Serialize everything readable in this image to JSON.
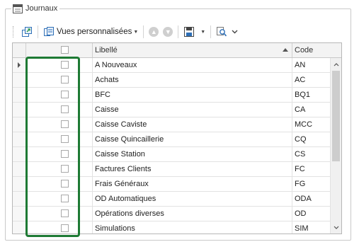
{
  "group": {
    "title": "Journaux",
    "icon": "ledger-icon"
  },
  "toolbar": {
    "export_icon": "export-icon",
    "views_icon": "views-icon",
    "views_label": "Vues personnalisées",
    "up_icon": "arrow-up-icon",
    "down_icon": "arrow-down-icon",
    "save_icon": "save-icon",
    "search_icon": "search-icon"
  },
  "grid": {
    "columns": {
      "libelle": "Libellé",
      "code": "Code"
    },
    "sort": {
      "column": "libelle",
      "direction": "ascending"
    },
    "rows": [
      {
        "libelle": "A Nouveaux",
        "code": "AN",
        "checked": false,
        "current": true
      },
      {
        "libelle": "Achats",
        "code": "AC",
        "checked": false
      },
      {
        "libelle": "BFC",
        "code": "BQ1",
        "checked": false
      },
      {
        "libelle": "Caisse",
        "code": "CA",
        "checked": false
      },
      {
        "libelle": "Caisse Caviste",
        "code": "MCC",
        "checked": false
      },
      {
        "libelle": "Caisse Quincaillerie",
        "code": "CQ",
        "checked": false
      },
      {
        "libelle": "Caisse Station",
        "code": "CS",
        "checked": false
      },
      {
        "libelle": "Factures Clients",
        "code": "FC",
        "checked": false
      },
      {
        "libelle": "Frais Généraux",
        "code": "FG",
        "checked": false
      },
      {
        "libelle": "OD Automatiques",
        "code": "ODA",
        "checked": false
      },
      {
        "libelle": "Opérations diverses",
        "code": "OD",
        "checked": false
      },
      {
        "libelle": "Simulations",
        "code": "SIM",
        "checked": false
      }
    ]
  },
  "colors": {
    "highlight": "#1e7a34",
    "accent": "#2e6fb7"
  }
}
